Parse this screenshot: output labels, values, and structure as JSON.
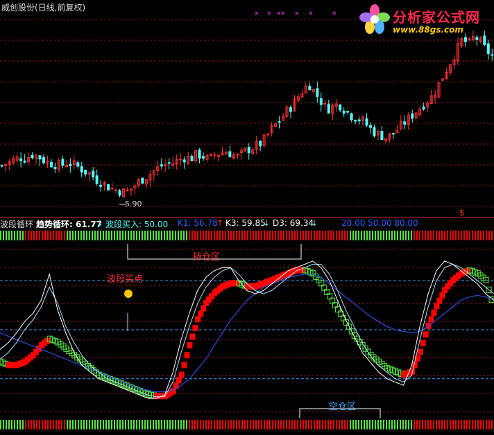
{
  "title": "威创股份(日线,前复权)",
  "watermark": {
    "name": "分析家公式网",
    "url": "www.88gs.com"
  },
  "colors": {
    "up": "#ff3232",
    "down": "#54fcfc",
    "grid": "#8c1a1a",
    "background": "#000000",
    "buy_block": "#ff0000",
    "sell_block": "#54e83c",
    "trend_line": "#2f4fe0",
    "fast_line": "#ffffff",
    "slow_line": "#a8e4ff",
    "ref_line": "#3ba3ff"
  },
  "price_low_label": "5.90",
  "dollar_mark": "$",
  "indicator": {
    "name": "波段循环",
    "trend_label": "趋势循环: 61.77",
    "buy_label": "波段买入: 50.00",
    "k1_label": "K1: 56.78",
    "k3_label": "K3: 59.85",
    "d3_label": "D3: 69.34",
    "levels_label": "20.00  50.00  80.00",
    "down_arrow": "↓",
    "up_arrow": "↑"
  },
  "annotations": {
    "hold_zone": "持仓区",
    "empty_zone": "空仓区",
    "buy_point": "波段买点"
  },
  "chart_data": [
    {
      "type": "candlestick",
      "title": "威创股份(日线,前复权)",
      "low_marker": 5.9,
      "close_series": [
        6.9,
        7.0,
        7.1,
        7.2,
        7.15,
        7.3,
        7.25,
        7.1,
        7.0,
        6.95,
        6.9,
        7.0,
        6.95,
        6.85,
        6.7,
        6.6,
        6.4,
        6.3,
        6.15,
        6.05,
        6.0,
        5.95,
        6.1,
        6.3,
        6.45,
        6.6,
        6.75,
        6.9,
        6.95,
        7.0,
        7.1,
        7.2,
        7.15,
        7.3,
        7.25,
        7.1,
        7.3,
        7.35,
        7.4,
        7.3,
        7.2,
        7.4,
        7.5,
        7.6,
        7.7,
        8.0,
        8.3,
        8.5,
        8.8,
        9.0,
        9.3,
        9.6,
        9.8,
        9.5,
        9.2,
        8.9,
        9.0,
        9.1,
        8.9,
        8.7,
        8.6,
        8.5,
        8.3,
        8.1,
        8.0,
        7.9,
        8.0,
        8.2,
        8.4,
        8.6,
        8.8,
        9.0,
        9.2,
        9.4,
        9.8,
        10.2,
        10.6,
        11.0,
        11.4,
        11.2,
        11.5,
        11.3,
        11.0,
        10.8
      ]
    },
    {
      "type": "line",
      "title": "波段循环",
      "ylim": [
        0,
        100
      ],
      "reference_levels": [
        20,
        50,
        80
      ],
      "x": [
        0,
        4,
        8,
        12,
        16,
        20,
        24,
        28,
        32,
        36,
        40,
        44,
        48,
        52,
        56,
        60,
        64,
        68,
        72,
        76,
        80,
        84,
        88,
        92,
        96,
        100,
        104,
        108,
        112,
        116,
        120,
        124,
        128,
        132,
        136,
        140,
        144,
        148,
        152,
        156,
        160,
        164,
        168,
        172,
        176,
        180,
        184,
        188,
        192,
        196,
        200,
        204,
        208,
        212,
        216,
        220,
        224,
        228,
        232,
        236,
        240
      ],
      "series": [
        {
          "name": "K1",
          "values": [
            38,
            42,
            48,
            55,
            60,
            68,
            84,
            62,
            48,
            36,
            28,
            24,
            20,
            18,
            16,
            14,
            12,
            10,
            8,
            8,
            10,
            24,
            44,
            60,
            74,
            82,
            86,
            88,
            88,
            80,
            74,
            72,
            74,
            78,
            82,
            86,
            88,
            90,
            92,
            88,
            80,
            68,
            56,
            46,
            36,
            30,
            24,
            20,
            18,
            16,
            28,
            52,
            72,
            86,
            92,
            90,
            86,
            82,
            78,
            72,
            68
          ]
        },
        {
          "name": "K3",
          "values": [
            32,
            36,
            42,
            50,
            56,
            64,
            76,
            66,
            52,
            42,
            34,
            28,
            24,
            20,
            18,
            16,
            14,
            12,
            10,
            9,
            9,
            18,
            36,
            52,
            66,
            76,
            82,
            86,
            88,
            84,
            78,
            74,
            72,
            74,
            78,
            82,
            86,
            88,
            90,
            90,
            84,
            74,
            62,
            52,
            42,
            34,
            28,
            24,
            20,
            18,
            22,
            44,
            64,
            80,
            88,
            90,
            88,
            84,
            80,
            76,
            72
          ]
        },
        {
          "name": "D3",
          "values": [
            48,
            46,
            44,
            42,
            40,
            38,
            36,
            34,
            32,
            30,
            28,
            26,
            24,
            22,
            20,
            18,
            16,
            14,
            13,
            12,
            12,
            13,
            16,
            20,
            26,
            32,
            40,
            48,
            56,
            62,
            68,
            72,
            76,
            78,
            80,
            82,
            83,
            84,
            84,
            82,
            78,
            74,
            70,
            66,
            62,
            58,
            55,
            52,
            50,
            49,
            48,
            49,
            52,
            56,
            60,
            64,
            68,
            70,
            71,
            70,
            69
          ]
        },
        {
          "name": "趋势循环",
          "values": [
            30,
            28,
            28,
            30,
            34,
            40,
            44,
            42,
            38,
            34,
            30,
            26,
            22,
            20,
            18,
            16,
            14,
            12,
            10,
            9,
            9,
            12,
            22,
            40,
            56,
            66,
            72,
            76,
            78,
            78,
            76,
            76,
            78,
            80,
            82,
            84,
            86,
            86,
            84,
            78,
            70,
            62,
            54,
            46,
            40,
            34,
            30,
            26,
            24,
            22,
            24,
            36,
            52,
            64,
            74,
            80,
            84,
            86,
            84,
            80,
            62
          ]
        }
      ]
    }
  ]
}
